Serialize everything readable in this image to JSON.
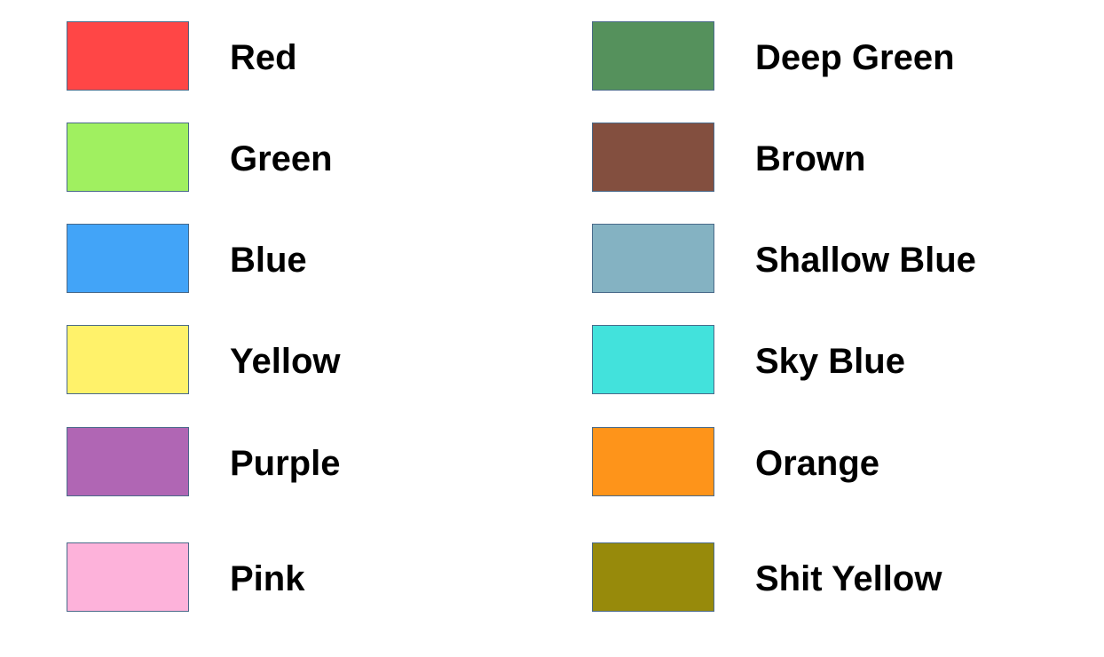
{
  "legend": {
    "left": [
      {
        "label": "Red",
        "color": "#ff4646"
      },
      {
        "label": "Green",
        "color": "#a0f060"
      },
      {
        "label": "Blue",
        "color": "#42a4f8"
      },
      {
        "label": "Yellow",
        "color": "#fff26a"
      },
      {
        "label": "Purple",
        "color": "#b066b4"
      },
      {
        "label": "Pink",
        "color": "#fdb2da"
      }
    ],
    "right": [
      {
        "label": "Deep Green",
        "color": "#55915c"
      },
      {
        "label": "Brown",
        "color": "#834f3f"
      },
      {
        "label": "Shallow Blue",
        "color": "#84b2c2"
      },
      {
        "label": "Sky Blue",
        "color": "#42e2dc"
      },
      {
        "label": "Orange",
        "color": "#fe941a"
      },
      {
        "label": "Shit Yellow",
        "color": "#978a0b"
      }
    ]
  }
}
